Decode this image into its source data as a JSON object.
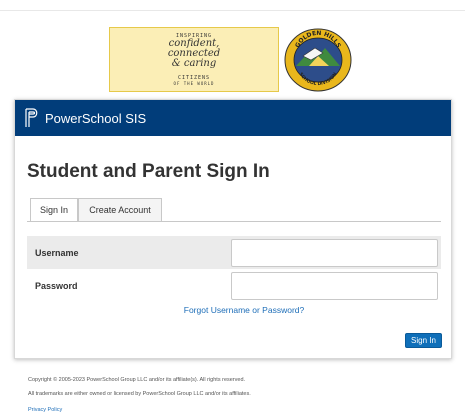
{
  "banner": {
    "line1": "INSPIRING",
    "line2": "confident,",
    "line3": "connected",
    "line4": "& caring",
    "line5": "CITIZENS",
    "line6": "OF THE WORLD"
  },
  "crest": {
    "top_text": "GOLDEN HILLS",
    "bottom_text": "SCHOOL DIVISION"
  },
  "header": {
    "app_title": "PowerSchool SIS"
  },
  "page_title": "Student and Parent Sign In",
  "tabs": [
    {
      "label": "Sign In",
      "active": true
    },
    {
      "label": "Create Account",
      "active": false
    }
  ],
  "form": {
    "username_label": "Username",
    "username_value": "",
    "password_label": "Password",
    "password_value": "",
    "forgot_link": "Forgot Username or Password?",
    "submit_label": "Sign In"
  },
  "footer": {
    "copyright": "Copyright © 2005-2023 PowerSchool Group LLC and/or its affiliate(s). All rights reserved.",
    "trademarks": "All trademarks are either owned or licensed by PowerSchool Group LLC and/or its affiliates.",
    "privacy": "Privacy Policy"
  },
  "colors": {
    "header_bg": "#013d7a",
    "button_bg": "#0f6fb9",
    "link": "#1e6eb8",
    "banner_bg": "#fbeeb6"
  }
}
